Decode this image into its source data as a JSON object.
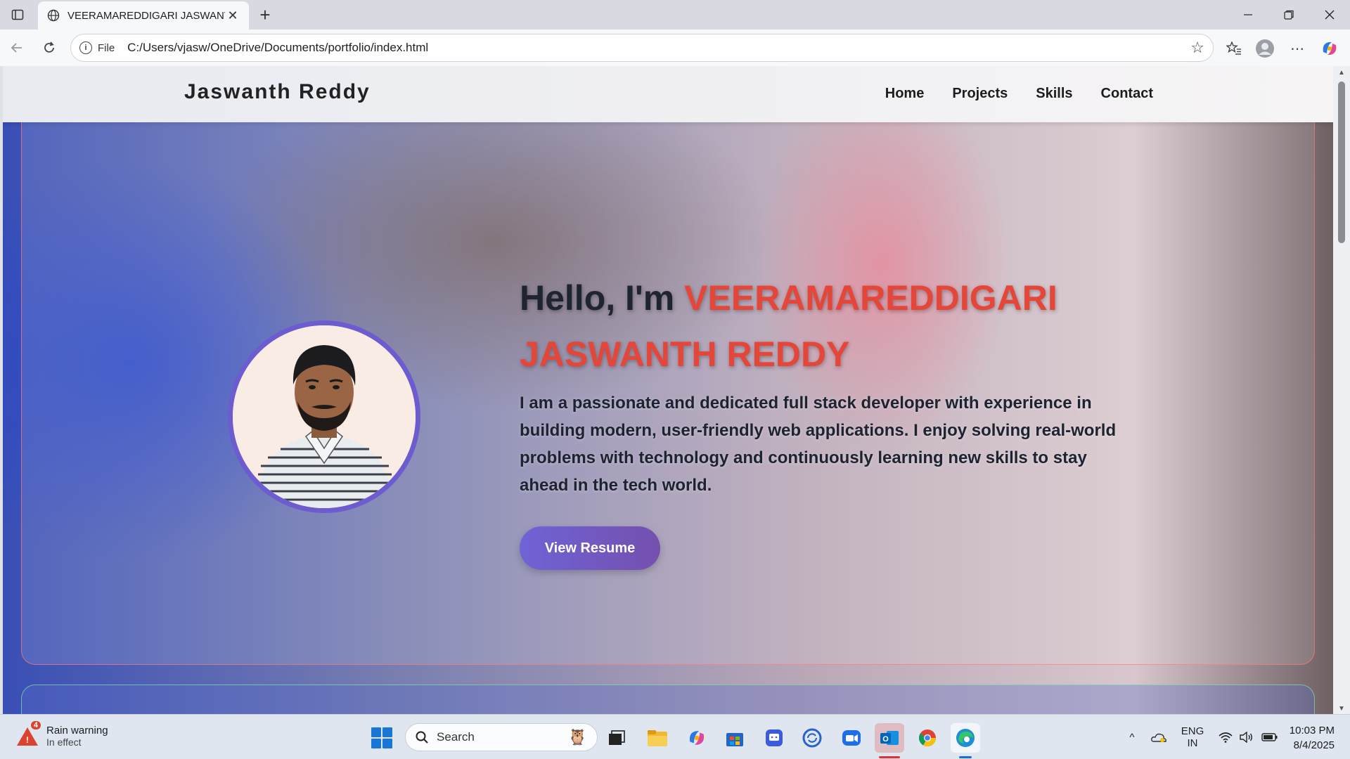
{
  "browser": {
    "tab_title": "VEERAMAREDDIGARI JASWANTH",
    "url_scheme": "File",
    "url": "C:/Users/vjasw/OneDrive/Documents/portfolio/index.html"
  },
  "site": {
    "brand": "Jaswanth Reddy",
    "nav": [
      "Home",
      "Projects",
      "Skills",
      "Contact"
    ],
    "hero": {
      "greeting": "Hello, I'm ",
      "name": "VEERAMAREDDIGARI JASWANTH REDDY",
      "description": "I am a passionate and dedicated full stack developer with experience in building modern, user-friendly web applications. I enjoy solving real-world problems with technology and continuously learning new skills to stay ahead in the tech world.",
      "button": "View Resume"
    }
  },
  "taskbar": {
    "weather_title": "Rain warning",
    "weather_sub": "In effect",
    "weather_badge": "4",
    "search_label": "Search",
    "lang_line1": "ENG",
    "lang_line2": "IN",
    "time": "10:03 PM",
    "date": "8/4/2025"
  }
}
